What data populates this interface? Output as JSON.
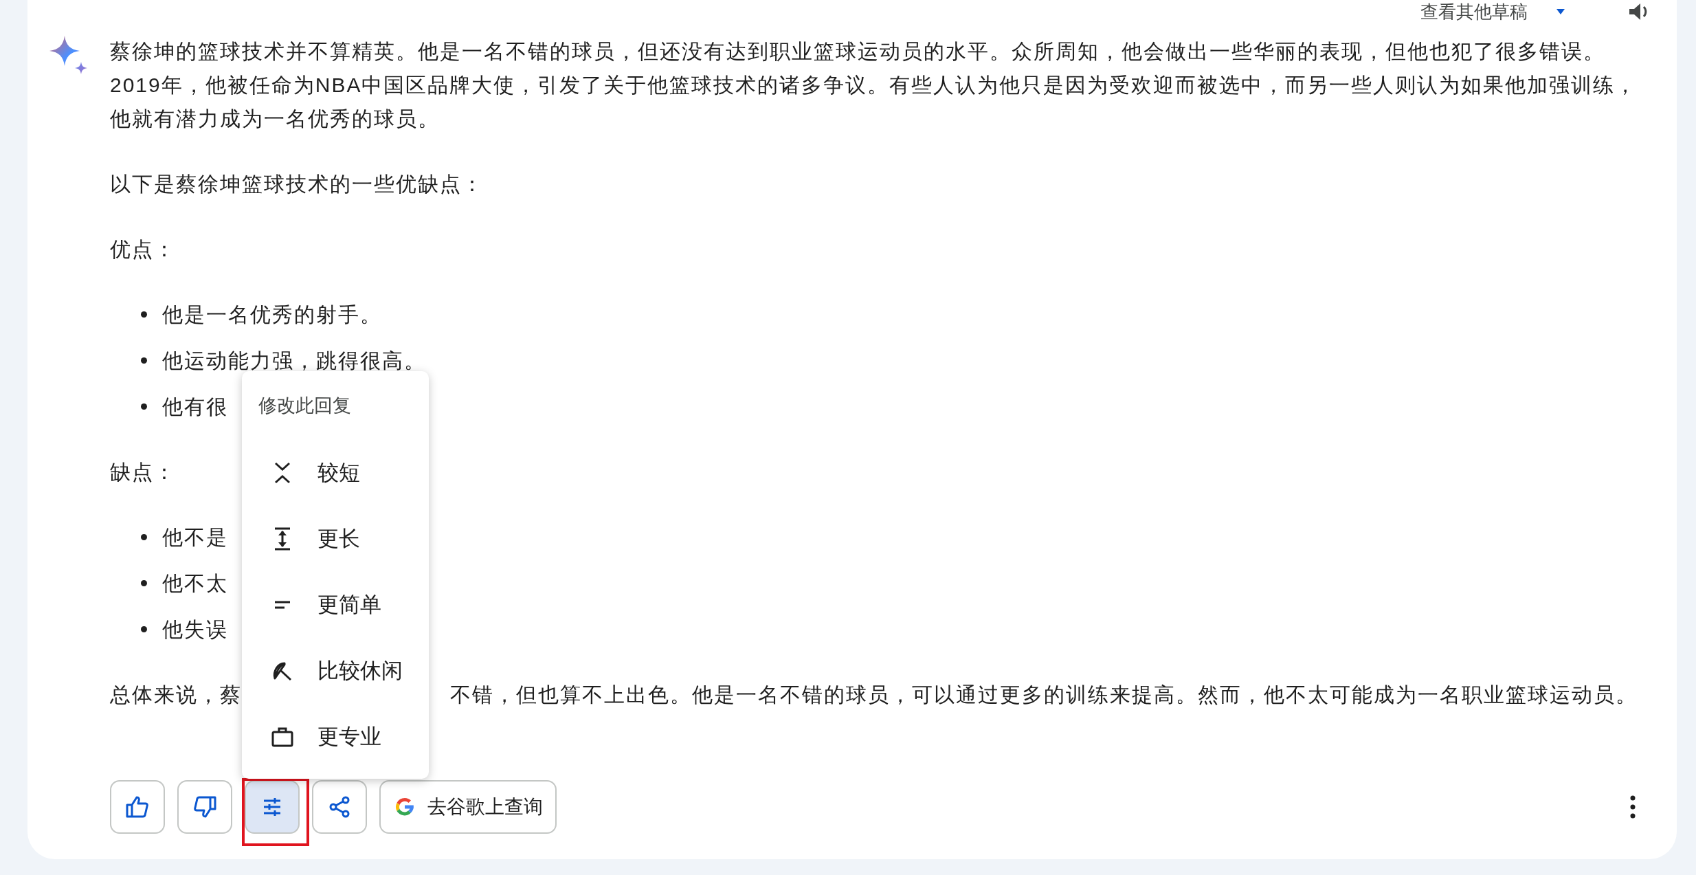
{
  "header": {
    "drafts_label": "查看其他草稿"
  },
  "response": {
    "blocks": [
      {
        "kind": "paragraph",
        "text": "蔡徐坤的篮球技术并不算精英。他是一名不错的球员，但还没有达到职业篮球运动员的水平。众所周知，他会做出一些华丽的表现，但他也犯了很多错误。2019年，他被任命为NBA中国区品牌大使，引发了关于他篮球技术的诸多争议。有些人认为他只是因为受欢迎而被选中，而另一些人则认为如果他加强训练，他就有潜力成为一名优秀的球员。"
      },
      {
        "kind": "paragraph",
        "text": "以下是蔡徐坤篮球技术的一些优缺点："
      },
      {
        "kind": "paragraph",
        "text": "优点："
      },
      {
        "kind": "bullets",
        "items": [
          "他是一名优秀的射手。",
          "他运动能力强，跳得很高。",
          "他有很"
        ]
      },
      {
        "kind": "paragraph",
        "text": "缺点："
      },
      {
        "kind": "bullets",
        "items": [
          "他不是",
          "他不太",
          "他失误"
        ]
      },
      {
        "kind": "split",
        "left": "总体来说，蔡",
        "right": "不错，但也算不上出色。他是一名不错的球员，可以通过更多的训练来提高。然而，他不太可能成为一名职业篮球运动员。"
      }
    ]
  },
  "actions": [
    {
      "kind": "thumbs-up",
      "selected": false,
      "highlighted": false
    },
    {
      "kind": "thumbs-down",
      "selected": false,
      "highlighted": false
    },
    {
      "kind": "modify",
      "selected": true,
      "highlighted": true
    },
    {
      "kind": "share",
      "selected": false,
      "highlighted": false
    },
    {
      "kind": "google",
      "label": "去谷歌上查询",
      "selected": false,
      "highlighted": false
    }
  ],
  "menu": {
    "title": "修改此回复",
    "items": [
      {
        "kind": "shorter",
        "label": "较短"
      },
      {
        "kind": "longer",
        "label": "更长"
      },
      {
        "kind": "simpler",
        "label": "更简单"
      },
      {
        "kind": "casual",
        "label": "比较休闲"
      },
      {
        "kind": "professional",
        "label": "更专业"
      }
    ]
  }
}
